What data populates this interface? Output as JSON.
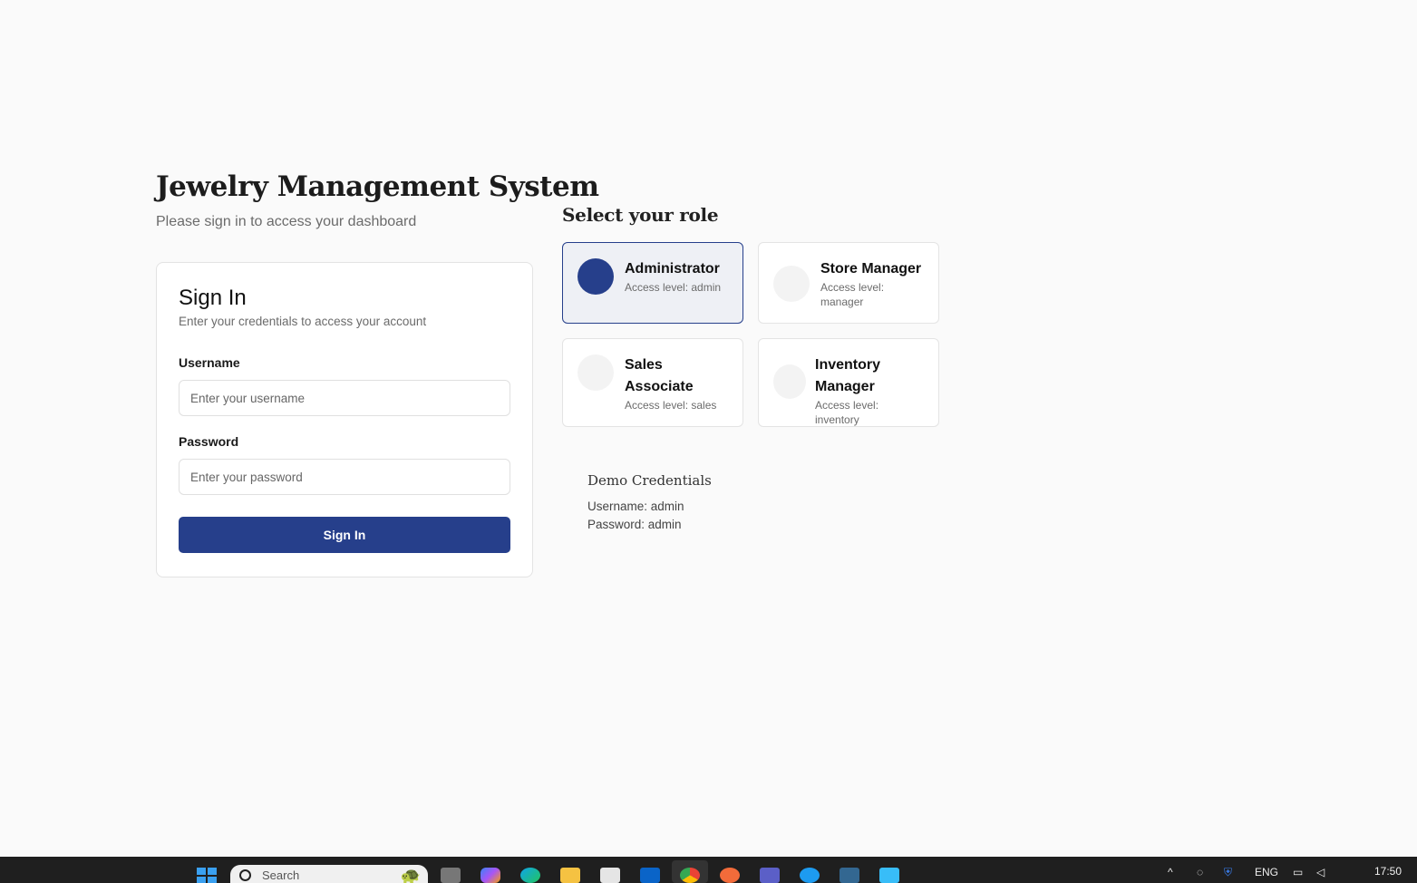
{
  "header": {
    "title": "Jewelry Management System",
    "subtitle": "Please sign in to access your dashboard"
  },
  "signin": {
    "title": "Sign In",
    "description": "Enter your credentials to access your account",
    "username_label": "Username",
    "username_placeholder": "Enter your username",
    "password_label": "Password",
    "password_placeholder": "Enter your password",
    "submit_label": "Sign In"
  },
  "roles": {
    "heading": "Select your role",
    "selected": "Administrator",
    "access_prefix": "Access level:",
    "items": [
      {
        "name": "Administrator",
        "level": "admin"
      },
      {
        "name": "Store Manager",
        "level": "manager"
      },
      {
        "name": "Sales Associate",
        "level": "sales"
      },
      {
        "name": "Inventory Manager",
        "level": "inventory"
      }
    ]
  },
  "demo": {
    "title": "Demo Credentials",
    "username_line": "Username: admin",
    "password_line": "Password: admin"
  },
  "taskbar": {
    "search_placeholder": "Search",
    "language": "ENG",
    "time": "17:50"
  },
  "colors": {
    "primary": "#263f8b",
    "background": "#fafafa",
    "selected_card": "#eef0f5",
    "taskbar": "#1f1f1f"
  }
}
